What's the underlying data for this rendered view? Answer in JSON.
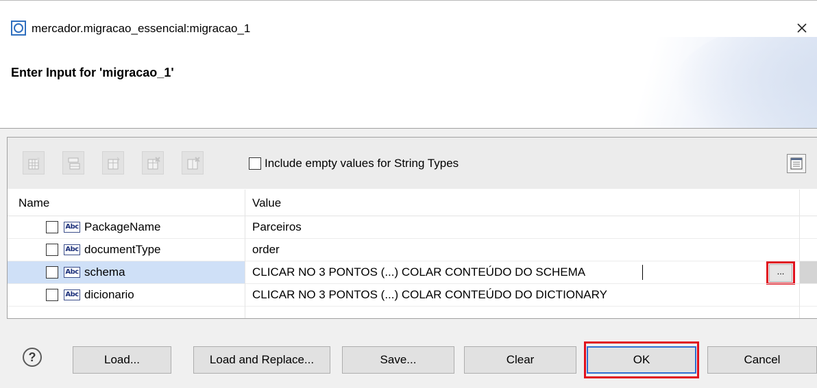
{
  "window": {
    "title": "mercador.migracao_essencial:migracao_1",
    "close_symbol": "✕"
  },
  "header": {
    "title": "Enter Input for 'migracao_1'"
  },
  "toolbar": {
    "buttons": [
      {
        "icon": "insert-row-icon"
      },
      {
        "icon": "insert-list-icon"
      },
      {
        "icon": "insert-child-icon"
      },
      {
        "icon": "delete-row-icon"
      },
      {
        "icon": "delete-all-icon"
      }
    ],
    "include_empty_label": "Include empty values for String Types",
    "layout_icon": "table-layout-icon"
  },
  "grid": {
    "columns": [
      "Name",
      "Value"
    ],
    "type_badge": "Abc",
    "rows": [
      {
        "name": "PackageName",
        "value": "Parceiros",
        "selected": false
      },
      {
        "name": "documentType",
        "value": "order",
        "selected": false
      },
      {
        "name": "schema",
        "value": "CLICAR NO 3 PONTOS (...) COLAR CONTEÚDO DO SCHEMA",
        "selected": true
      },
      {
        "name": "dicionario",
        "value": "CLICAR NO 3 PONTOS (...) COLAR CONTEÚDO DO DICTIONARY",
        "selected": false
      }
    ],
    "ellipsis_label": "..."
  },
  "footer": {
    "help_symbol": "?",
    "buttons": {
      "load": "Load...",
      "load_replace": "Load and Replace...",
      "save": "Save...",
      "clear": "Clear",
      "ok": "OK",
      "cancel": "Cancel"
    }
  },
  "colors": {
    "highlight": "#e0101d",
    "selection": "#cfe0f7",
    "ok_border": "#2f6fd1"
  }
}
